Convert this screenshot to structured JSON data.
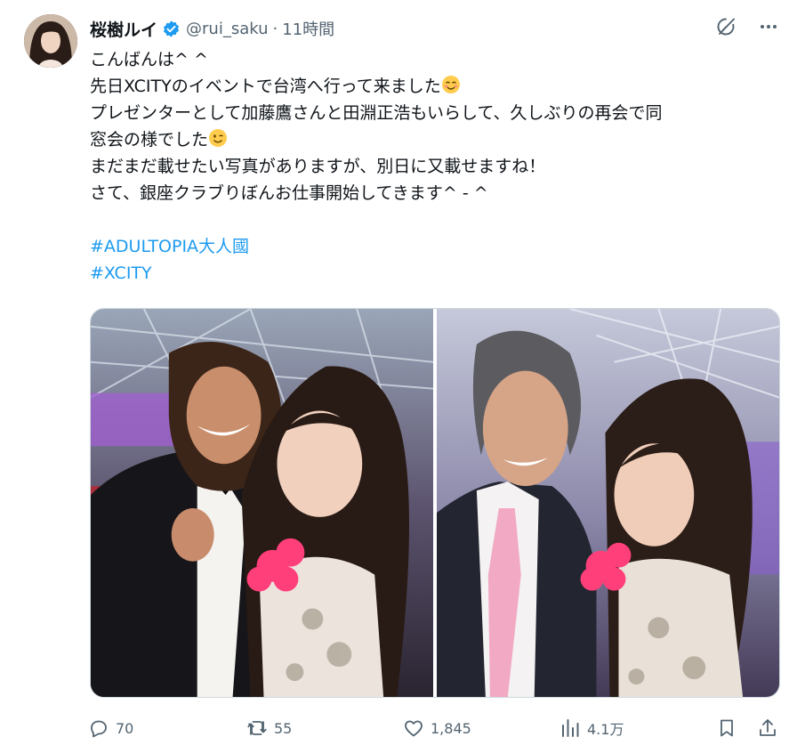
{
  "author": {
    "display_name": "桜樹ルイ",
    "handle": "@rui_saku",
    "separator": "·",
    "time": "11時間",
    "verified": true,
    "verified_color": "#1d9bf0"
  },
  "header_icons": [
    "grok-icon",
    "more-icon"
  ],
  "tweet": {
    "lines": [
      "こんばんは^ ^",
      "先日XCITYのイベントで台湾へ行って来ました",
      "プレゼンターとして加藤鷹さんと田淵正浩もいらして、久しぶりの再会で同",
      "窓会の様でした",
      "まだまだ載せたい写真がありますが、別日に又載せますね！",
      "さて、銀座クラブりぼんお仕事開始してきます^ - ^"
    ],
    "hashtags": [
      "#ADULTOPIA大人國",
      "#XCITY"
    ],
    "hashtag_color": "#1d9bf0"
  },
  "media": [
    {
      "alt": "photo-1"
    },
    {
      "alt": "photo-2"
    }
  ],
  "actions": {
    "reply_count": "70",
    "retweet_count": "55",
    "like_count": "1,845",
    "view_count": "4.1万"
  },
  "colors": {
    "text": "#0f1419",
    "secondary": "#536471",
    "accent": "#1d9bf0"
  }
}
